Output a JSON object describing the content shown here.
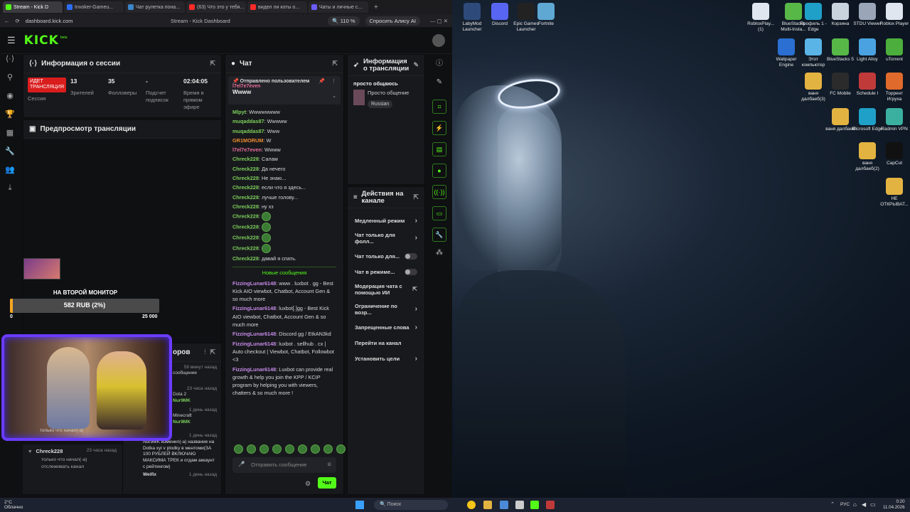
{
  "browser": {
    "tabs": [
      {
        "label": "Stream - Kick D",
        "color": "#53fc18",
        "active": true
      },
      {
        "label": "Invoker-Gameu...",
        "color": "#2d6df6"
      },
      {
        "label": "Чат рулетка пона...",
        "color": "#3a86c8"
      },
      {
        "label": "(63) Что это у тебя...",
        "color": "#ff2a2a"
      },
      {
        "label": "видел ли коты о...",
        "color": "#ff2a2a"
      },
      {
        "label": "Чаты и личные с...",
        "color": "#6a5cff"
      }
    ],
    "url": "dashboard.kick.com",
    "page_title": "Stream - Kick Dashboard",
    "zoom": "110 %",
    "alice_label": "Спросить Алису AI"
  },
  "kick": {
    "logo": "KICK",
    "beta": "beta"
  },
  "session": {
    "title": "Информация о сессии",
    "live_badge": "ИДЕТ ТРАНСЛЯЦИЯ",
    "session_label": "Сессия",
    "stats": [
      {
        "value": "13",
        "label": "Зрителей"
      },
      {
        "value": "35",
        "label": "Фолловеры"
      },
      {
        "value": "-",
        "label": "Подсчет подписок"
      },
      {
        "value": "02:04:05",
        "label": "Время в прямом эфире"
      }
    ]
  },
  "preview": {
    "title": "Предпросмотр трансляции",
    "overlay_text": "НА ВТОРОЙ МОНИТОР",
    "goal_amount": "582 RUB (2%)",
    "goal_min": "0",
    "goal_max": "25 000",
    "goal_fraction": 0.02
  },
  "activity": {
    "title_fragment": "оров",
    "items": [
      {
        "time": "59 минут назад",
        "text": "сообщение"
      },
      {
        "time": "23 часа назад",
        "text": "Dota 2",
        "user": "Nur9MK"
      },
      {
        "time": "1 день назад",
        "text": "Minecraft",
        "user": "Nur9MK"
      },
      {
        "user": "Chreck228",
        "time": "23 часа назад",
        "text": "только что начал(-а) отслеживать канал"
      },
      {
        "user": "Название",
        "time": "1 день назад",
        "text": "Nur9MK изменил(-а) название на Dotka xyi v plodky в ментоми(ЗА 100 РУБЛЕЙ ВКЛЮЧАЮ МАКСИМА ТРЕК и отдам аккаунт с рейтингом)"
      },
      {
        "user": "Weifix",
        "time": "1 день назад",
        "text": ""
      }
    ],
    "partial_text": "только что начал(-а)"
  },
  "chat": {
    "title": "Чат",
    "pinned_label": "Отправлено пользователем",
    "pinned_user": "l7el7e7even",
    "pinned_msg": "Wwww",
    "messages": [
      {
        "user": "Mlpyt",
        "color": "u-lime",
        "text": "Wwwwwwww"
      },
      {
        "user": "muqaddas87",
        "color": "u-lime",
        "text": "Wwwww"
      },
      {
        "user": "muqaddas87",
        "color": "u-lime",
        "text": "Www"
      },
      {
        "user": "GR1MORUM",
        "color": "u-orange",
        "text": "W"
      },
      {
        "user": "l7el7e7even",
        "color": "u-pink",
        "text": "Wwww"
      },
      {
        "user": "Chreck228",
        "color": "u-lime",
        "text": "Салам"
      },
      {
        "user": "Chreck228",
        "color": "u-lime",
        "text": "Да нечего"
      },
      {
        "user": "Chreck228",
        "color": "u-lime",
        "text": "Не знаю..."
      },
      {
        "user": "Chreck228",
        "color": "u-lime",
        "text": "если что я здесь..."
      },
      {
        "user": "Chreck228",
        "color": "u-lime",
        "text": "лучше голову..."
      },
      {
        "user": "Chreck228",
        "color": "u-lime",
        "text": "ну хз"
      },
      {
        "user": "Chreck228",
        "color": "u-lime",
        "text": "",
        "emote": true
      },
      {
        "user": "Chreck228",
        "color": "u-lime",
        "text": "",
        "emote": true
      },
      {
        "user": "Chreck228",
        "color": "u-lime",
        "text": "",
        "emote": true
      },
      {
        "user": "Chreck228",
        "color": "u-lime",
        "text": "",
        "emote": true
      },
      {
        "user": "Chreck228",
        "color": "u-lime",
        "text": "давай я спать."
      }
    ],
    "new_messages_label": "Новые сообщения",
    "new_messages": [
      {
        "user": "FizzingLunar6148",
        "color": "u-purple",
        "text": "www . luxbot . gg - Best Kick AIO viewbot, Chatbot, Account Gen & so much more"
      },
      {
        "user": "FizzingLunar6148",
        "color": "u-purple",
        "text": "luxbot[.]gg - Best Kick AIO viewbot, Chatbot, Account Gen & so much more"
      },
      {
        "user": "FizzingLunar6148",
        "color": "u-purple",
        "text": "Discord gg / EtkAN3kd"
      },
      {
        "user": "FizzingLunar6148",
        "color": "u-purple",
        "text": "luxbot . sellhub . cx | Auto checkout | Viewbot, Chatbot, Followbot <3"
      },
      {
        "user": "FizzingLunar6148",
        "color": "u-purple",
        "text": "Luxbot can provide real growth & help you join the KPP / KCIP program by helping you with viewers, chatters & so much more !"
      }
    ],
    "input_placeholder": "Отправить сообщение",
    "send_label": "Чат"
  },
  "stream_info": {
    "title": "Информация о трансляции",
    "stream_title": "просто общаюсь",
    "category": "Просто общение",
    "language": "Russian"
  },
  "channel_actions": {
    "title": "Действия на канале",
    "items": [
      {
        "label": "Медленный режим",
        "kind": "chevron"
      },
      {
        "label": "Чат только для фолл...",
        "kind": "chevron"
      },
      {
        "label": "Чат только для...",
        "kind": "toggle"
      },
      {
        "label": "Чат в режиме...",
        "kind": "toggle"
      },
      {
        "label": "Модерация чата с помощью ИИ",
        "kind": "external"
      },
      {
        "label": "Ограничение по возр...",
        "kind": "chevron"
      },
      {
        "label": "Запрещенные слова",
        "kind": "chevron"
      },
      {
        "label": "Перейти на канал",
        "kind": "none"
      },
      {
        "label": "Установить цели",
        "kind": "chevron"
      }
    ]
  },
  "desktop": {
    "icons": [
      {
        "label": "LabyMod Launcher",
        "color": "#2d4a7a"
      },
      {
        "label": "Discord",
        "color": "#5865f2"
      },
      {
        "label": "Epic Games Launcher",
        "color": "#222"
      },
      {
        "label": "Fortnite",
        "color": "#5fa8d3"
      },
      {
        "label": "RobloxPlay... (1)",
        "color": "#e0e6f0"
      },
      {
        "label": "BlueStacks Multi-Insta...",
        "color": "#57b847"
      },
      {
        "label": "Профиль 1 - Edge",
        "color": "#1fa0c8"
      },
      {
        "label": "Корзина",
        "color": "#c8d3de"
      },
      {
        "label": "STDU Viewer",
        "color": "#9aa6b8"
      },
      {
        "label": "Roblox Player",
        "color": "#e0e6f0"
      },
      {
        "label": "Wallpaper Engine",
        "color": "#2a6fd1"
      },
      {
        "label": "Этот компьютер",
        "color": "#5bb4e6"
      },
      {
        "label": "BlueStacks 5",
        "color": "#57b847"
      },
      {
        "label": "Light Alloy",
        "color": "#4aa3e0"
      },
      {
        "label": "uTorrent",
        "color": "#4cae3c"
      },
      {
        "label": "ваня далбаеб(3)",
        "color": "#e3b341"
      },
      {
        "label": "FC Mobile",
        "color": "#2b2b2b"
      },
      {
        "label": "Schedule I",
        "color": "#c03a3a"
      },
      {
        "label": "Торрент Игруха",
        "color": "#e06a2c"
      },
      {
        "label": "ваня далбаеб",
        "color": "#e3b341"
      },
      {
        "label": "Microsoft Edge",
        "color": "#1fa0c8"
      },
      {
        "label": "Radmin VPN",
        "color": "#3bb0a0"
      },
      {
        "label": "ваня далбаеб(2)",
        "color": "#e3b341"
      },
      {
        "label": "CapCut",
        "color": "#111"
      },
      {
        "label": "НЕ ОТКРЫВАТ...",
        "color": "#e3b341"
      }
    ]
  },
  "taskbar": {
    "weather_temp": "2°C",
    "weather_text": "Облачно",
    "search_label": "Поиск",
    "lang": "РУС",
    "time": "0:20",
    "date": "11.04.2026"
  }
}
